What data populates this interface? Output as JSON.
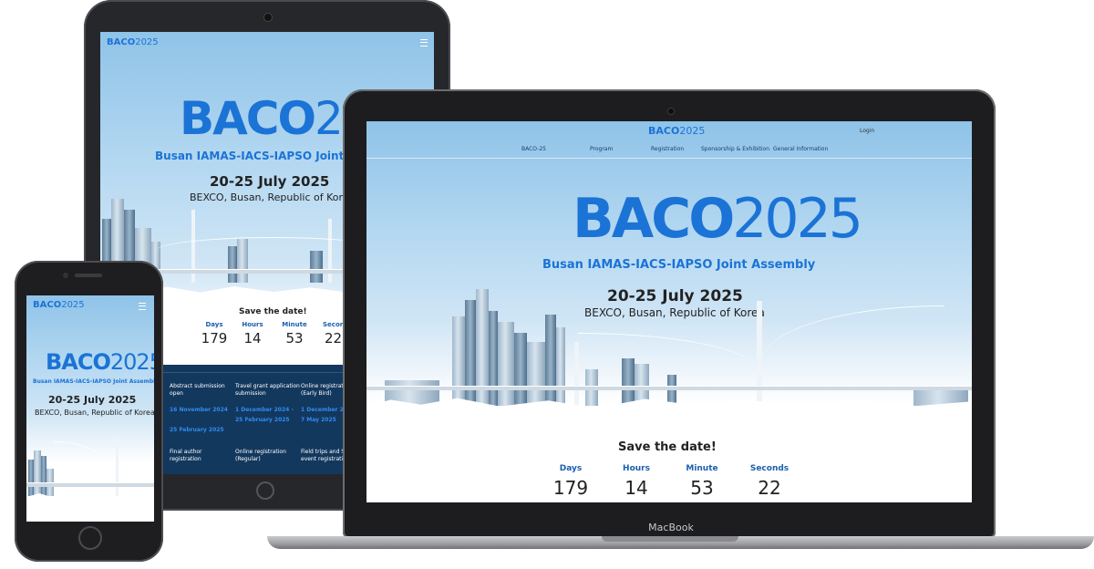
{
  "brand": {
    "baco": "BACO",
    "year": "2025"
  },
  "subtitle": "Busan IAMAS-IACS-IAPSO Joint Assembly",
  "subtitle_tablet": "Busan IAMAS-IACS-IAPSO Joint As",
  "dates": "20-25 July 2025",
  "location": "BEXCO, Busan, Republic of Korea",
  "nav": {
    "login": "Login",
    "items": [
      "BACO-25",
      "Program",
      "Registration",
      "Sponsorship & Exhibition",
      "General Information"
    ]
  },
  "countdown": {
    "heading": "Save the date!",
    "labels": {
      "days": "Days",
      "hours": "Hours",
      "minute": "Minute",
      "seconds": "Seconds",
      "seconds_cut": "Second"
    },
    "values": {
      "days": "179",
      "hours": "14",
      "minute": "53",
      "seconds": "22",
      "seconds_cut": "22"
    }
  },
  "tablet_info": {
    "row1": [
      {
        "title_l1": "Abstract submission",
        "title_l2": "open",
        "date_l1": "16 November 2024",
        "date_l2": "25 February 2025"
      },
      {
        "title_l1": "Travel grant application",
        "title_l2": "submission",
        "date_l1": "1 December 2024 -",
        "date_l2": "25 February 2025"
      },
      {
        "title_l1": "Online registration",
        "title_l2": "(Early Bird)",
        "date_l1": "1 December 2",
        "date_l2": "7 May 2025"
      }
    ],
    "row2": [
      {
        "title_l1": "Final author",
        "title_l2": "registration"
      },
      {
        "title_l1": "Online registration",
        "title_l2": "(Regular)"
      },
      {
        "title_l1": "Field trips and So",
        "title_l2": "event registration"
      }
    ]
  },
  "laptop_brand": "MacBook",
  "colors": {
    "accent": "#1b73d6",
    "label_blue": "#1b5fae",
    "info_bg": "#13385e",
    "date_blue": "#2f8cf0"
  }
}
